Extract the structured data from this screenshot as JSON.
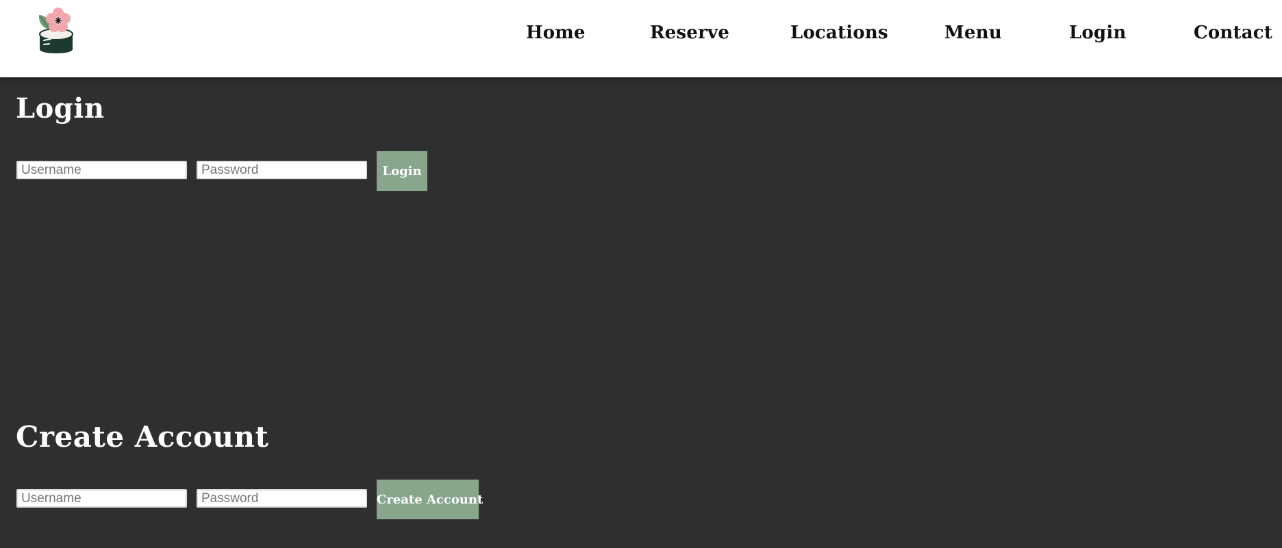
{
  "nav": {
    "logo_icon": "sushi-flower-logo-icon",
    "items": [
      "Home",
      "Reserve",
      "Locations",
      "Menu",
      "Login",
      "Contact"
    ]
  },
  "login": {
    "title": "Login",
    "username_placeholder": "Username",
    "password_placeholder": "Password",
    "button_label": "Login"
  },
  "create": {
    "title": "Create Account",
    "username_placeholder": "Username",
    "password_placeholder": "Password",
    "button_label": "Create Account"
  },
  "colors": {
    "page_background": "#2f2f2f",
    "header_background": "#ffffff",
    "button_green": "#88a68b",
    "logo_pink": "#f2a7ae",
    "logo_dark_green": "#1c3a2f"
  }
}
